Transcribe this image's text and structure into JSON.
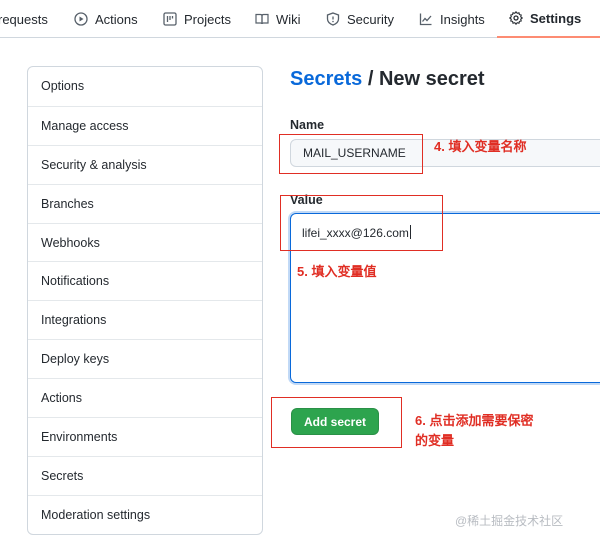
{
  "tabs": [
    {
      "label": "requests"
    },
    {
      "label": "Actions"
    },
    {
      "label": "Projects"
    },
    {
      "label": "Wiki"
    },
    {
      "label": "Security"
    },
    {
      "label": "Insights"
    },
    {
      "label": "Settings",
      "active": true
    }
  ],
  "sidebar": {
    "items": [
      {
        "label": "Options"
      },
      {
        "label": "Manage access"
      },
      {
        "label": "Security & analysis"
      },
      {
        "label": "Branches"
      },
      {
        "label": "Webhooks"
      },
      {
        "label": "Notifications"
      },
      {
        "label": "Integrations"
      },
      {
        "label": "Deploy keys"
      },
      {
        "label": "Actions"
      },
      {
        "label": "Environments"
      },
      {
        "label": "Secrets",
        "selected": true
      },
      {
        "label": "Moderation settings"
      }
    ]
  },
  "page": {
    "title_link": "Secrets",
    "title_rest": " / New secret"
  },
  "form": {
    "name_label": "Name",
    "name_value": "MAIL_USERNAME",
    "value_label": "Value",
    "value_text": "lifei_xxxx@126.com",
    "submit_label": "Add secret"
  },
  "annotations": {
    "step4": "4. 填入变量名称",
    "step5": "5. 填入变量值",
    "step6": "6. 点击添加需要保密的变量"
  },
  "watermark": "@稀土掘金技术社区",
  "colors": {
    "link": "#0969da",
    "primary_button": "#2da44e",
    "annotation": "#e02e24",
    "active_tab_underline": "#fd8c73"
  }
}
